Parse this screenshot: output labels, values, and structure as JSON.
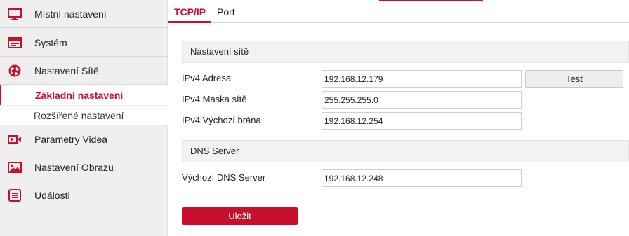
{
  "sidebar": {
    "items": [
      {
        "label": "Místní nastavení",
        "icon": "monitor-icon"
      },
      {
        "label": "Systém",
        "icon": "system-icon"
      },
      {
        "label": "Nastavení Sítě",
        "icon": "globe-icon"
      },
      {
        "label": "Parametry Videa",
        "icon": "video-icon"
      },
      {
        "label": "Nastavení Obrazu",
        "icon": "image-icon"
      },
      {
        "label": "Události",
        "icon": "events-icon"
      }
    ],
    "subitems": [
      {
        "label": "Základní nastavení",
        "active": true
      },
      {
        "label": "Rozšířené nastavení",
        "active": false
      }
    ]
  },
  "tabs": [
    {
      "label": "TCP/IP",
      "active": true
    },
    {
      "label": "Port",
      "active": false
    }
  ],
  "network": {
    "section_title": "Nastavení sítě",
    "ipv4_address_label": "IPv4 Adresa",
    "ipv4_address_value": "192.168.12.179",
    "ipv4_mask_label": "IPv4 Maska sítě",
    "ipv4_mask_value": "255.255.255.0",
    "ipv4_gateway_label": "IPv4 Výchozí brána",
    "ipv4_gateway_value": "192.168.12.254",
    "test_label": "Test"
  },
  "dns": {
    "section_title": "DNS Server",
    "default_dns_label": "Výchozí DNS Server",
    "default_dns_value": "192.168.12.248"
  },
  "save_label": "Uložit",
  "colors": {
    "accent": "#c8102e",
    "sidebar_bg": "#efefef",
    "section_bg": "#f2f2f2"
  }
}
